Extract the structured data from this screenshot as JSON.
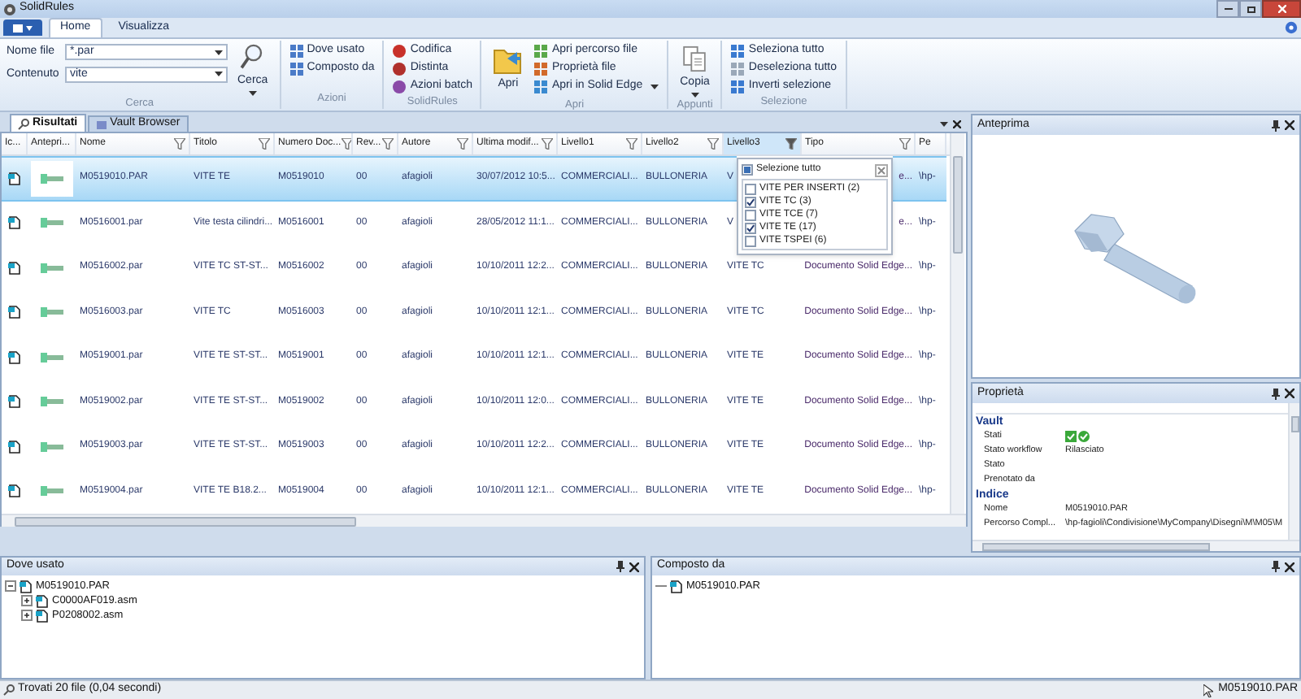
{
  "window": {
    "title": "SolidRules"
  },
  "ribbon": {
    "tabs": [
      {
        "label": "Home",
        "selected": true
      },
      {
        "label": "Visualizza",
        "selected": false
      }
    ],
    "groups": [
      {
        "label": "Cerca",
        "kind": "search",
        "fields": [
          {
            "label": "Nome file",
            "value": "*.par"
          },
          {
            "label": "Contenuto",
            "value": "vite"
          }
        ],
        "large": {
          "label": "Cerca",
          "dropdown": true
        }
      },
      {
        "label": "Azioni",
        "kind": "buttons",
        "items": [
          {
            "label": "Dove usato",
            "dropdown": false
          },
          {
            "label": "Composto da",
            "dropdown": false
          }
        ]
      },
      {
        "label": "SolidRules",
        "kind": "buttons",
        "items": [
          {
            "label": "Codifica",
            "dropdown": false
          },
          {
            "label": "Distinta",
            "dropdown": false
          },
          {
            "label": "Azioni batch",
            "dropdown": false
          }
        ]
      },
      {
        "label": "Apri",
        "kind": "buttons",
        "large": {
          "label": "Apri",
          "dropdown": false
        },
        "items": [
          {
            "label": "Apri percorso file",
            "dropdown": false
          },
          {
            "label": "Proprietà file",
            "dropdown": false
          },
          {
            "label": "Apri in Solid Edge",
            "dropdown": true
          }
        ]
      },
      {
        "label": "Appunti",
        "kind": "buttons",
        "large": {
          "label": "Copia",
          "dropdown": true
        }
      },
      {
        "label": "Selezione",
        "kind": "buttons",
        "items": [
          {
            "label": "Seleziona tutto",
            "dropdown": false
          },
          {
            "label": "Deseleziona tutto",
            "dropdown": false
          },
          {
            "label": "Inverti selezione",
            "dropdown": false
          }
        ]
      }
    ]
  },
  "results": {
    "tabs": [
      {
        "label": "Risultati",
        "selected": true
      },
      {
        "label": "Vault Browser",
        "selected": false
      }
    ],
    "columns": [
      {
        "label": "Ic...",
        "filter": false,
        "active": false
      },
      {
        "label": "Antepri...",
        "filter": false,
        "active": false
      },
      {
        "label": "Nome",
        "filter": true,
        "active": false
      },
      {
        "label": "Titolo",
        "filter": true,
        "active": false
      },
      {
        "label": "Numero Doc...",
        "filter": true,
        "active": false
      },
      {
        "label": "Rev...",
        "filter": true,
        "active": false
      },
      {
        "label": "Autore",
        "filter": true,
        "active": false
      },
      {
        "label": "Ultima modif...",
        "filter": true,
        "active": false
      },
      {
        "label": "Livello1",
        "filter": true,
        "active": false
      },
      {
        "label": "Livello2",
        "filter": true,
        "active": false
      },
      {
        "label": "Livello3",
        "filter": true,
        "active": true
      },
      {
        "label": "Tipo",
        "filter": true,
        "active": false
      },
      {
        "label": "Pe",
        "filter": false,
        "active": false
      }
    ],
    "rows": [
      {
        "selected": true,
        "cells": [
          {
            "kind": "icon"
          },
          {
            "kind": "picture"
          },
          "M0519010.PAR",
          "VITE TE",
          "M0519010",
          "00",
          "afagioli",
          "30/07/2012 10:5...",
          "COMMERCIALI...",
          "BULLONERIA",
          "V",
          "e...",
          "\\hp-"
        ]
      },
      {
        "selected": false,
        "cells": [
          {
            "kind": "icon"
          },
          {
            "kind": "picture"
          },
          "M0516001.par",
          "Vite testa cilindri...",
          "M0516001",
          "00",
          "afagioli",
          "28/05/2012 11:1...",
          "COMMERCIALI...",
          "BULLONERIA",
          "V",
          "e...",
          "\\hp-"
        ]
      },
      {
        "selected": false,
        "cells": [
          {
            "kind": "icon"
          },
          {
            "kind": "picture"
          },
          "M0516002.par",
          "VITE TC ST-ST...",
          "M0516002",
          "00",
          "afagioli",
          "10/10/2011 12:2...",
          "COMMERCIALI...",
          "BULLONERIA",
          "VITE TC",
          "Documento Solid Edge...",
          "\\hp-"
        ]
      },
      {
        "selected": false,
        "cells": [
          {
            "kind": "icon"
          },
          {
            "kind": "picture"
          },
          "M0516003.par",
          "VITE TC",
          "M0516003",
          "00",
          "afagioli",
          "10/10/2011 12:1...",
          "COMMERCIALI...",
          "BULLONERIA",
          "VITE TC",
          "Documento Solid Edge...",
          "\\hp-"
        ]
      },
      {
        "selected": false,
        "cells": [
          {
            "kind": "icon"
          },
          {
            "kind": "picture"
          },
          "M0519001.par",
          "VITE TE ST-ST...",
          "M0519001",
          "00",
          "afagioli",
          "10/10/2011 12:1...",
          "COMMERCIALI...",
          "BULLONERIA",
          "VITE TE",
          "Documento Solid Edge...",
          "\\hp-"
        ]
      },
      {
        "selected": false,
        "cells": [
          {
            "kind": "icon"
          },
          {
            "kind": "picture"
          },
          "M0519002.par",
          "VITE TE ST-ST...",
          "M0519002",
          "00",
          "afagioli",
          "10/10/2011 12:0...",
          "COMMERCIALI...",
          "BULLONERIA",
          "VITE TE",
          "Documento Solid Edge...",
          "\\hp-"
        ]
      },
      {
        "selected": false,
        "cells": [
          {
            "kind": "icon"
          },
          {
            "kind": "picture"
          },
          "M0519003.par",
          "VITE TE ST-ST...",
          "M0519003",
          "00",
          "afagioli",
          "10/10/2011 12:2...",
          "COMMERCIALI...",
          "BULLONERIA",
          "VITE TE",
          "Documento Solid Edge...",
          "\\hp-"
        ]
      },
      {
        "selected": false,
        "cells": [
          {
            "kind": "icon"
          },
          {
            "kind": "picture"
          },
          "M0519004.par",
          "VITE TE B18.2...",
          "M0519004",
          "00",
          "afagioli",
          "10/10/2011 12:1...",
          "COMMERCIALI...",
          "BULLONERIA",
          "VITE TE",
          "Documento Solid Edge...",
          "\\hp-"
        ]
      }
    ],
    "filter_popup": {
      "select_all": {
        "label": "Selezione tutto",
        "indeterminate": true
      },
      "items": [
        {
          "label": "VITE PER INSERTI (2)",
          "checked": false
        },
        {
          "label": "VITE TC (3)",
          "checked": true
        },
        {
          "label": "VITE TCE (7)",
          "checked": false
        },
        {
          "label": "VITE TE (17)",
          "checked": true
        },
        {
          "label": "VITE TSPEI (6)",
          "checked": false
        }
      ]
    }
  },
  "preview": {
    "title": "Anteprima"
  },
  "properties": {
    "title": "Proprietà",
    "sections": [
      {
        "title": "Vault",
        "rows": [
          {
            "label": "Stati",
            "kind": "icons"
          },
          {
            "label": "Stato workflow",
            "kind": "text",
            "value": "Rilasciato"
          },
          {
            "label": "Stato",
            "kind": "text"
          },
          {
            "label": "Prenotato da",
            "kind": "text"
          }
        ]
      },
      {
        "title": "Indice",
        "rows": [
          {
            "label": "Nome",
            "kind": "text",
            "value": "M0519010.PAR"
          },
          {
            "label": "Percorso Compl...",
            "kind": "text",
            "value": "\\hp-fagioli\\Condivisione\\MyCompany\\Disegni\\M\\M05\\M"
          }
        ]
      }
    ]
  },
  "where_used": {
    "title": "Dove usato",
    "tree": [
      {
        "label": "M0519010.PAR",
        "expanded": true,
        "children": [
          {
            "label": "C0000AF019.asm",
            "expanded": false
          },
          {
            "label": "P0208002.asm",
            "expanded": false
          }
        ]
      }
    ]
  },
  "composed_of": {
    "title": "Composto da",
    "tree": [
      {
        "label": "M0519010.PAR"
      }
    ]
  },
  "status_bar": {
    "text": "Trovati 20 file (0,04 secondi)",
    "selection": "M0519010.PAR"
  }
}
